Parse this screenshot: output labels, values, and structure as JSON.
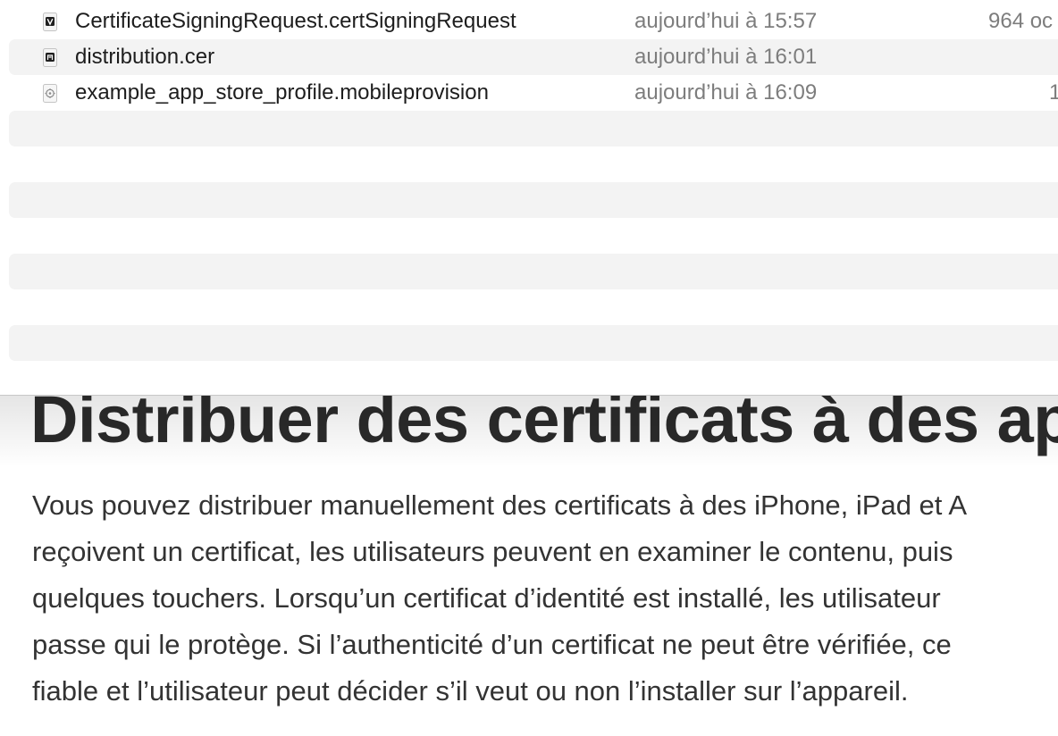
{
  "files": [
    {
      "name": "CertificateSigningRequest.certSigningRequest",
      "date": "aujourd’hui à 15:57",
      "size": "964 oc",
      "icon": "csr-file-icon"
    },
    {
      "name": "distribution.cer",
      "date": "aujourd’hui à 16:01",
      "size": "",
      "icon": "certificate-file-icon"
    },
    {
      "name": "example_app_store_profile.mobileprovision",
      "date": "aujourd’hui à 16:09",
      "size": "1",
      "icon": "provisioning-profile-icon"
    }
  ],
  "article": {
    "title": "Distribuer des certificats à des ap",
    "body_lines": [
      "Vous pouvez distribuer manuellement des certificats à des iPhone, iPad et A",
      "reçoivent un certificat, les utilisateurs peuvent en examiner le contenu, puis",
      "quelques touchers. Lorsqu’un certificat d’identité est installé, les utilisateur",
      "passe qui le protège. Si l’authenticité d’un certificat ne peut être vérifiée, ce",
      "fiable et l’utilisateur peut décider s’il veut ou non l’installer sur l’appareil."
    ]
  }
}
